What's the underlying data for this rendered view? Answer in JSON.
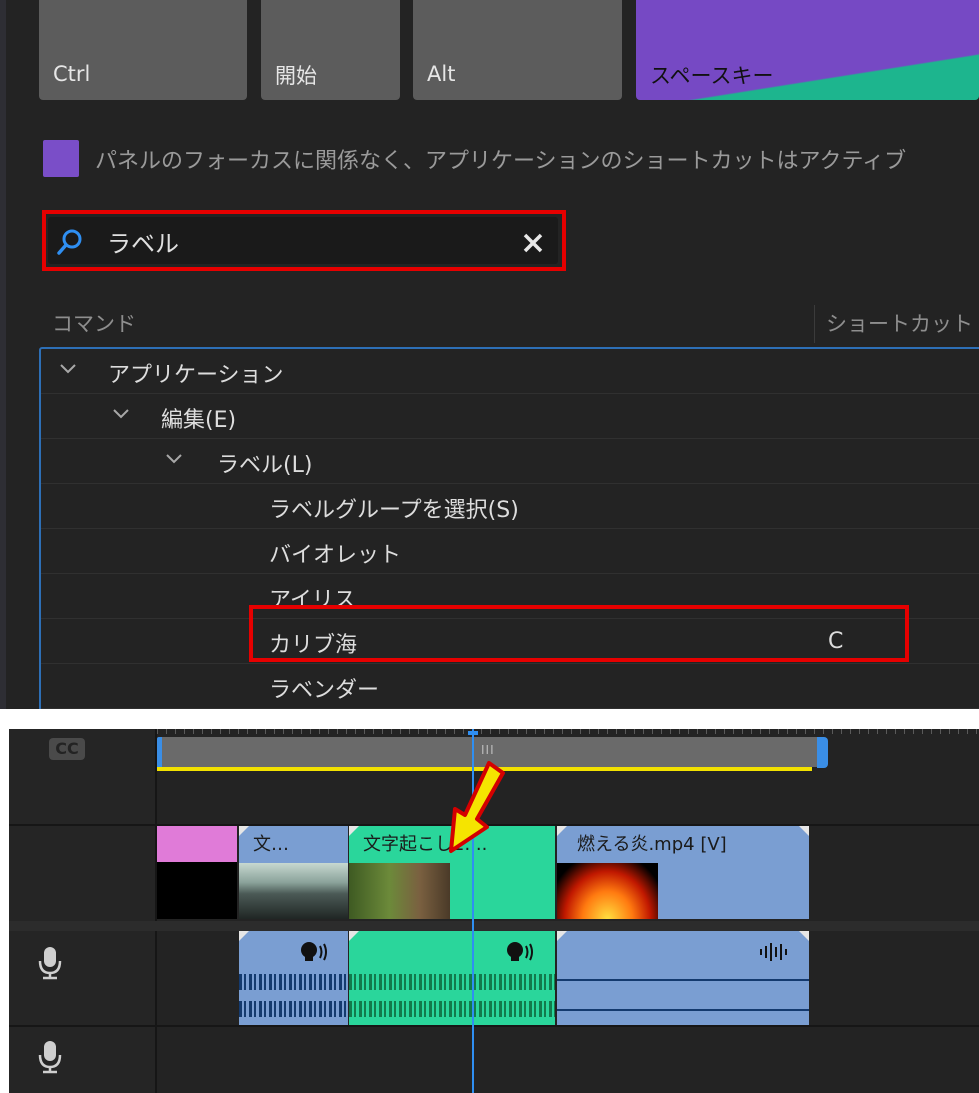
{
  "keyboard": {
    "keys": [
      {
        "label": "Ctrl"
      },
      {
        "label": "開始"
      },
      {
        "label": "Alt"
      },
      {
        "label": "スペースキー"
      }
    ],
    "legend_text": "パネルのフォーカスに関係なく、アプリケーションのショートカットはアクティブ",
    "legend_color": "#7a4ec8"
  },
  "search": {
    "value": "ラベル",
    "icon": "search-icon",
    "clear_icon": "close-icon"
  },
  "table": {
    "col_command": "コマンド",
    "col_shortcut": "ショートカット"
  },
  "tree": [
    {
      "label": "アプリケーション",
      "expanded": true,
      "level": 0,
      "shortcut": ""
    },
    {
      "label": "編集(E)",
      "expanded": true,
      "level": 1,
      "shortcut": ""
    },
    {
      "label": "ラベル(L)",
      "expanded": true,
      "level": 2,
      "shortcut": ""
    },
    {
      "label": "ラベルグループを選択(S)",
      "level": 3,
      "shortcut": ""
    },
    {
      "label": "バイオレット",
      "level": 3,
      "shortcut": ""
    },
    {
      "label": "アイリス",
      "level": 3,
      "shortcut": ""
    },
    {
      "label": "カリブ海",
      "level": 3,
      "shortcut": "C"
    },
    {
      "label": "ラベンダー",
      "level": 3,
      "shortcut": ""
    }
  ],
  "highlight_color": "#e60000",
  "timeline": {
    "cc_badge": "CC",
    "caption_grip": "III",
    "video_clips": [
      {
        "label": "",
        "color": "#e07bd8"
      },
      {
        "label": "文…",
        "color": "#7a9ed2"
      },
      {
        "label": "文字起こし2....",
        "color": "#2ad69b"
      },
      {
        "label": "燃える炎.mp4 [V]",
        "color": "#7a9ed2"
      }
    ],
    "audio_clips": [
      {
        "color": "#7a9ed2",
        "icon": "speech-icon"
      },
      {
        "color": "#2ad69b",
        "icon": "speech-icon"
      },
      {
        "color": "#7a9ed2",
        "icon": "waveform-icon"
      }
    ],
    "track_icons": [
      "microphone-icon",
      "microphone-icon"
    ],
    "playhead_color": "#2f8ff2",
    "annotation_arrow_color": "#f5e400"
  }
}
